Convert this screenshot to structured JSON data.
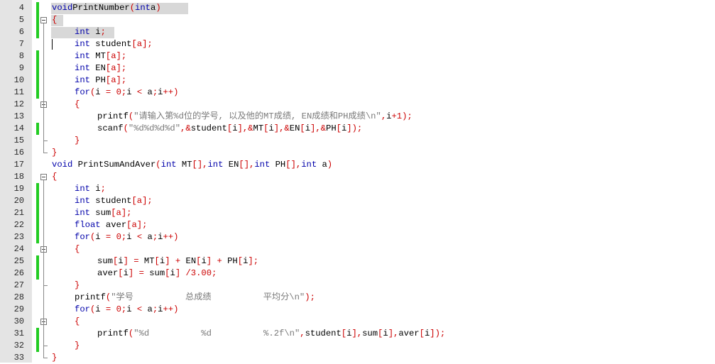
{
  "editor": {
    "lines": [
      {
        "n": "4",
        "changed": true,
        "segs": [
          [
            "k",
            "void"
          ],
          [
            "",
            "PrintNumber"
          ],
          [
            "p",
            "("
          ],
          [
            "k",
            "int"
          ],
          [
            "",
            "a"
          ],
          [
            "p",
            ")"
          ]
        ]
      },
      {
        "n": "5",
        "changed": true,
        "segs": [
          [
            "p",
            "{"
          ]
        ]
      },
      {
        "n": "6",
        "changed": true,
        "segs": [
          [
            "k",
            "int"
          ],
          [
            "",
            " i"
          ],
          [
            "p",
            ";"
          ]
        ]
      },
      {
        "n": "7",
        "changed": false,
        "segs": [
          [
            "k",
            "int"
          ],
          [
            "",
            " student"
          ],
          [
            "p",
            "[a];"
          ]
        ]
      },
      {
        "n": "8",
        "changed": true,
        "segs": [
          [
            "k",
            "int"
          ],
          [
            "",
            " MT"
          ],
          [
            "p",
            "[a];"
          ]
        ]
      },
      {
        "n": "9",
        "changed": true,
        "segs": [
          [
            "k",
            "int"
          ],
          [
            "",
            " EN"
          ],
          [
            "p",
            "[a];"
          ]
        ]
      },
      {
        "n": "10",
        "changed": true,
        "segs": [
          [
            "k",
            "int"
          ],
          [
            "",
            " PH"
          ],
          [
            "p",
            "[a];"
          ]
        ]
      },
      {
        "n": "11",
        "changed": true,
        "segs": [
          [
            "k",
            "for"
          ],
          [
            "p",
            "("
          ],
          [
            "",
            "i "
          ],
          [
            "p",
            "="
          ],
          [
            "",
            " "
          ],
          [
            "p",
            "0"
          ],
          [
            "p",
            ";"
          ],
          [
            "",
            "i "
          ],
          [
            "p",
            "<"
          ],
          [
            "",
            " a"
          ],
          [
            "p",
            ";"
          ],
          [
            "",
            "i"
          ],
          [
            "p",
            "++)"
          ]
        ]
      },
      {
        "n": "12",
        "changed": false,
        "segs": [
          [
            "p",
            "{"
          ]
        ]
      },
      {
        "n": "13",
        "changed": false,
        "segs": [
          [
            "",
            "printf"
          ],
          [
            "p",
            "("
          ],
          [
            "s",
            "\"请输入第%d位的学号, 以及他的MT成绩, EN成绩和PH成绩\\n\""
          ],
          [
            "p",
            ","
          ],
          [
            "",
            "i"
          ],
          [
            "p",
            "+1);"
          ]
        ]
      },
      {
        "n": "14",
        "changed": true,
        "segs": [
          [
            "",
            "scanf"
          ],
          [
            "p",
            "("
          ],
          [
            "s",
            "\"%d%d%d%d\""
          ],
          [
            "p",
            ",&"
          ],
          [
            "",
            "student"
          ],
          [
            "p",
            "["
          ],
          [
            "",
            "i"
          ],
          [
            "p",
            "],&"
          ],
          [
            "",
            "MT"
          ],
          [
            "p",
            "["
          ],
          [
            "",
            "i"
          ],
          [
            "p",
            "],&"
          ],
          [
            "",
            "EN"
          ],
          [
            "p",
            "["
          ],
          [
            "",
            "i"
          ],
          [
            "p",
            "],&"
          ],
          [
            "",
            "PH"
          ],
          [
            "p",
            "["
          ],
          [
            "",
            "i"
          ],
          [
            "p",
            "]);"
          ]
        ]
      },
      {
        "n": "15",
        "changed": false,
        "segs": [
          [
            "p",
            "}"
          ]
        ]
      },
      {
        "n": "16",
        "changed": false,
        "segs": [
          [
            "p",
            "}"
          ]
        ]
      },
      {
        "n": "17",
        "changed": false,
        "segs": [
          [
            "k",
            "void"
          ],
          [
            "",
            " PrintSumAndAver"
          ],
          [
            "p",
            "("
          ],
          [
            "k",
            "int"
          ],
          [
            "",
            " MT"
          ],
          [
            "p",
            "[],"
          ],
          [
            "k",
            "int"
          ],
          [
            "",
            " EN"
          ],
          [
            "p",
            "[],"
          ],
          [
            "k",
            "int"
          ],
          [
            "",
            " PH"
          ],
          [
            "p",
            "[],"
          ],
          [
            "k",
            "int"
          ],
          [
            "",
            " a"
          ],
          [
            "p",
            ")"
          ]
        ]
      },
      {
        "n": "18",
        "changed": false,
        "segs": [
          [
            "p",
            "{"
          ]
        ]
      },
      {
        "n": "19",
        "changed": true,
        "segs": [
          [
            "k",
            "int"
          ],
          [
            "",
            " i"
          ],
          [
            "p",
            ";"
          ]
        ]
      },
      {
        "n": "20",
        "changed": true,
        "segs": [
          [
            "k",
            "int"
          ],
          [
            "",
            " student"
          ],
          [
            "p",
            "[a];"
          ]
        ]
      },
      {
        "n": "21",
        "changed": true,
        "segs": [
          [
            "k",
            "int"
          ],
          [
            "",
            " sum"
          ],
          [
            "p",
            "[a];"
          ]
        ]
      },
      {
        "n": "22",
        "changed": true,
        "segs": [
          [
            "k",
            "float"
          ],
          [
            "",
            " aver"
          ],
          [
            "p",
            "[a];"
          ]
        ]
      },
      {
        "n": "23",
        "changed": true,
        "segs": [
          [
            "k",
            "for"
          ],
          [
            "p",
            "("
          ],
          [
            "",
            "i "
          ],
          [
            "p",
            "="
          ],
          [
            "",
            " "
          ],
          [
            "p",
            "0"
          ],
          [
            "p",
            ";"
          ],
          [
            "",
            "i "
          ],
          [
            "p",
            "<"
          ],
          [
            "",
            " a"
          ],
          [
            "p",
            ";"
          ],
          [
            "",
            "i"
          ],
          [
            "p",
            "++)"
          ]
        ]
      },
      {
        "n": "24",
        "changed": false,
        "segs": [
          [
            "p",
            "{"
          ]
        ]
      },
      {
        "n": "25",
        "changed": true,
        "segs": [
          [
            "",
            "sum"
          ],
          [
            "p",
            "["
          ],
          [
            "",
            "i"
          ],
          [
            "p",
            "]"
          ],
          [
            "",
            " "
          ],
          [
            "p",
            "="
          ],
          [
            "",
            " MT"
          ],
          [
            "p",
            "["
          ],
          [
            "",
            "i"
          ],
          [
            "p",
            "]"
          ],
          [
            "",
            " "
          ],
          [
            "p",
            "+"
          ],
          [
            "",
            " EN"
          ],
          [
            "p",
            "["
          ],
          [
            "",
            "i"
          ],
          [
            "p",
            "]"
          ],
          [
            "",
            " "
          ],
          [
            "p",
            "+"
          ],
          [
            "",
            " PH"
          ],
          [
            "p",
            "["
          ],
          [
            "",
            "i"
          ],
          [
            "p",
            "];"
          ]
        ]
      },
      {
        "n": "26",
        "changed": true,
        "segs": [
          [
            "",
            "aver"
          ],
          [
            "p",
            "["
          ],
          [
            "",
            "i"
          ],
          [
            "p",
            "]"
          ],
          [
            "",
            " "
          ],
          [
            "p",
            "="
          ],
          [
            "",
            " sum"
          ],
          [
            "p",
            "["
          ],
          [
            "",
            "i"
          ],
          [
            "p",
            "]"
          ],
          [
            "",
            " "
          ],
          [
            "p",
            "/3.00;"
          ]
        ]
      },
      {
        "n": "27",
        "changed": false,
        "segs": [
          [
            "p",
            "}"
          ]
        ]
      },
      {
        "n": "28",
        "changed": false,
        "segs": [
          [
            "",
            "printf"
          ],
          [
            "p",
            "("
          ],
          [
            "s",
            "\"学号          总成绩          平均分\\n\""
          ],
          [
            "p",
            ");"
          ]
        ]
      },
      {
        "n": "29",
        "changed": false,
        "segs": [
          [
            "k",
            "for"
          ],
          [
            "p",
            "("
          ],
          [
            "",
            "i "
          ],
          [
            "p",
            "="
          ],
          [
            "",
            " "
          ],
          [
            "p",
            "0"
          ],
          [
            "p",
            ";"
          ],
          [
            "",
            "i "
          ],
          [
            "p",
            "<"
          ],
          [
            "",
            " a"
          ],
          [
            "p",
            ";"
          ],
          [
            "",
            "i"
          ],
          [
            "p",
            "++)"
          ]
        ]
      },
      {
        "n": "30",
        "changed": false,
        "segs": [
          [
            "p",
            "{"
          ]
        ]
      },
      {
        "n": "31",
        "changed": true,
        "segs": [
          [
            "",
            "printf"
          ],
          [
            "p",
            "("
          ],
          [
            "s",
            "\"%d          %d          %.2f\\n\""
          ],
          [
            "p",
            ","
          ],
          [
            "",
            "student"
          ],
          [
            "p",
            "["
          ],
          [
            "",
            "i"
          ],
          [
            "p",
            "],"
          ],
          [
            "",
            "sum"
          ],
          [
            "p",
            "["
          ],
          [
            "",
            "i"
          ],
          [
            "p",
            "],"
          ],
          [
            "",
            "aver"
          ],
          [
            "p",
            "["
          ],
          [
            "",
            "i"
          ],
          [
            "p",
            "]);"
          ]
        ]
      },
      {
        "n": "32",
        "changed": true,
        "segs": [
          [
            "p",
            "}"
          ]
        ]
      },
      {
        "n": "33",
        "changed": false,
        "segs": [
          [
            "p",
            "}"
          ]
        ]
      }
    ]
  },
  "colors": {
    "keyword": "#0000aa",
    "string": "#7a7a7a",
    "punct": "#cc0000",
    "changed_marker": "#22cc22",
    "gutter": "#e4e4e4"
  }
}
